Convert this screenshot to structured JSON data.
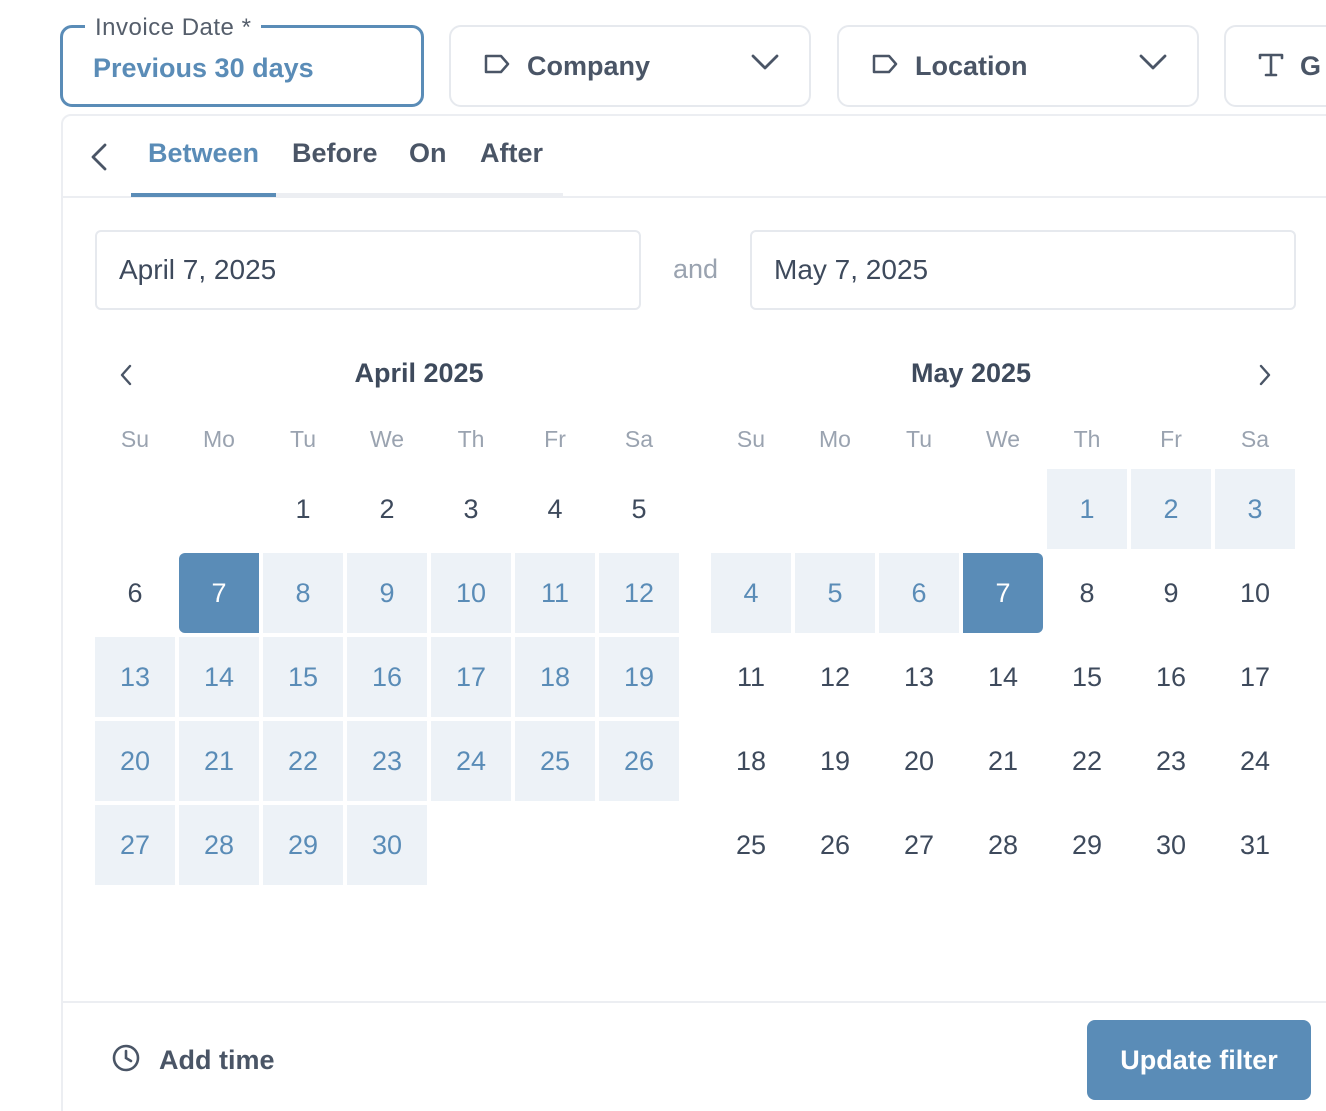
{
  "filters": {
    "invoice_date": {
      "legend": "Invoice Date *",
      "value": "Previous 30 days"
    },
    "company": {
      "label": "Company",
      "icon": "tag-icon"
    },
    "location": {
      "label": "Location",
      "icon": "tag-icon"
    },
    "text_filter": {
      "label": "G",
      "icon": "text-icon"
    }
  },
  "picker": {
    "tabs": [
      "Between",
      "Before",
      "On",
      "After"
    ],
    "active_tab": "Between",
    "start_value": "April 7, 2025",
    "end_value": "May 7, 2025",
    "and_label": "and",
    "weekdays": [
      "Su",
      "Mo",
      "Tu",
      "We",
      "Th",
      "Fr",
      "Sa"
    ],
    "months": [
      {
        "title": "April 2025",
        "first_weekday": 2,
        "days": 30,
        "range_from": 7,
        "range_to": 30,
        "selected_start": 7,
        "selected_end": null
      },
      {
        "title": "May 2025",
        "first_weekday": 4,
        "days": 31,
        "range_from": 1,
        "range_to": 7,
        "selected_start": null,
        "selected_end": 7
      }
    ],
    "add_time_label": "Add time",
    "update_label": "Update filter"
  },
  "colors": {
    "accent": "#5a8cb7",
    "range_bg": "#edf2f7",
    "border": "#e6e9ee"
  }
}
